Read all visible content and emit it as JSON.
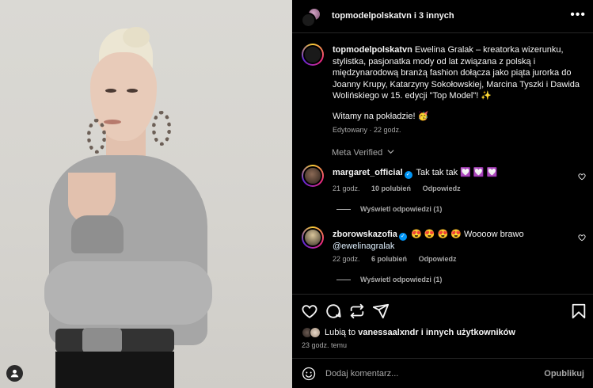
{
  "header": {
    "title": "topmodelpolskatvn i 3 innych",
    "more_glyph": "•••"
  },
  "caption": {
    "username": "topmodelpolskatvn",
    "text": "Ewelina Gralak – kreatorka wizerunku, stylistka, pasjonatka mody od lat związana z polską i międzynarodową branżą fashion dołącza jako piąta jurorka do Joanny Krupy, Katarzyny Sokołowskiej, Marcina Tyszki i Dawida Wolińskiego w 15. edycji \"Top Model\"! ✨",
    "second_line": "Witamy na pokładzie! 🥳",
    "meta": "Edytowany · 22 godz."
  },
  "meta_verified_label": "Meta Verified",
  "comments": [
    {
      "username": "margaret_official",
      "verified_glyph": "✓",
      "text": "Tak tak tak 💟 💟 💟",
      "time": "21 godz.",
      "likes": "10 polubień",
      "reply": "Odpowiedz",
      "view_replies": "Wyświetl odpowiedzi (1)"
    },
    {
      "username": "zborowskazofia",
      "verified_glyph": "✓",
      "text": "😍 😍 😍 😍 Woooow brawo",
      "mention": "@ewelinagralak",
      "time": "22 godz.",
      "likes": "6 polubień",
      "reply": "Odpowiedz",
      "view_replies": "Wyświetl odpowiedzi (1)"
    }
  ],
  "likes_line": {
    "prefix": "Lubią to",
    "user": "vanessaalxndr",
    "suffix": "i innych użytkowników"
  },
  "time_ago": "23 godz. temu",
  "add_comment": {
    "placeholder": "Dodaj komentarz...",
    "post_label": "Opublikuj"
  },
  "colors": {
    "background": "#000000",
    "text": "#f5f5f5",
    "secondary_text": "#a8a8a8",
    "verified_badge": "#0095f6",
    "divider": "#262626"
  },
  "icons": [
    "more-options-icon",
    "heart-icon",
    "comment-icon",
    "share-icon",
    "send-icon",
    "bookmark-icon",
    "emoji-icon",
    "user-tag-icon",
    "chevron-down-icon",
    "verified-badge-icon"
  ]
}
